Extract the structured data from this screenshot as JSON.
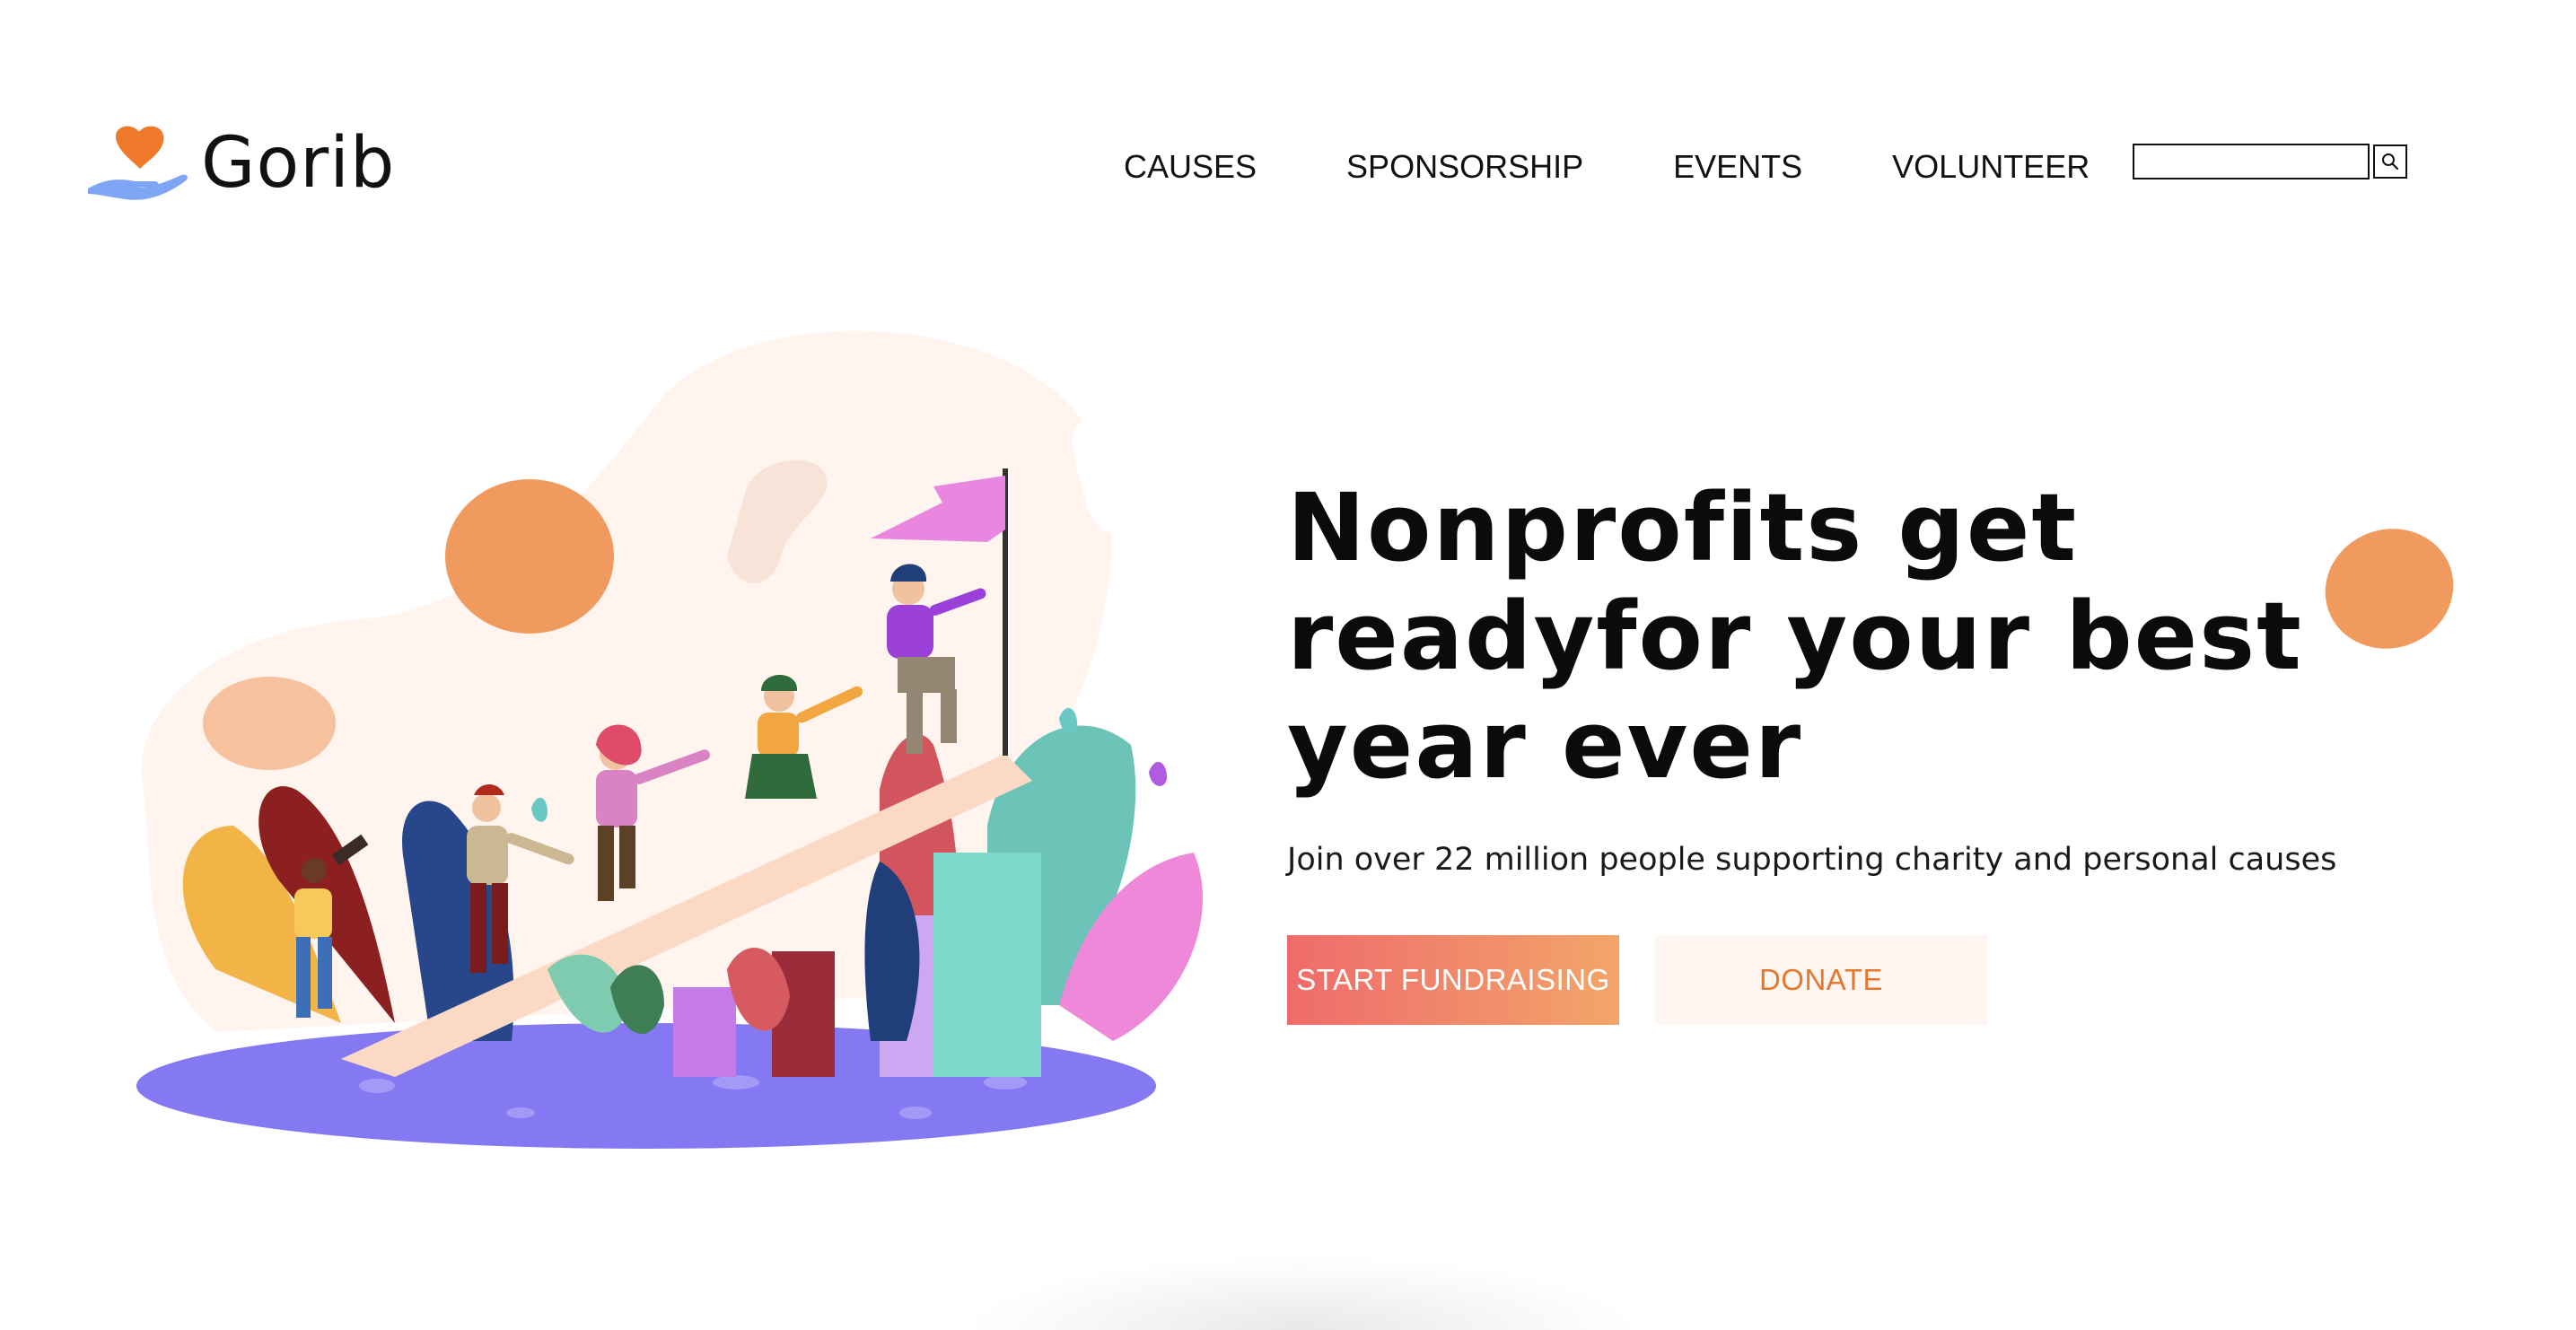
{
  "brand": {
    "name": "Gorib",
    "logo_icon": "heart-hand-icon"
  },
  "nav": {
    "items": [
      {
        "label": "CAUSES"
      },
      {
        "label": "SPONSORSHIP"
      },
      {
        "label": "EVENTS"
      },
      {
        "label": "VOLUNTEER"
      }
    ]
  },
  "search": {
    "value": "",
    "icon": "search-icon"
  },
  "hero": {
    "title": "Nonprofits get readyfor your best year ever",
    "subtitle": "Join over 22 million people supporting charity and personal causes",
    "primary_cta": "START FUNDRAISING",
    "secondary_cta": "DONATE",
    "illustration": "team-climbing-to-flag-illustration"
  },
  "colors": {
    "accent_orange": "#F09A5E",
    "cta_gradient_start": "#EF6B6B",
    "cta_gradient_end": "#F2A56A",
    "donate_text": "#E4782F",
    "donate_bg": "#FFF6F1",
    "platform_purple": "#8479F2"
  }
}
